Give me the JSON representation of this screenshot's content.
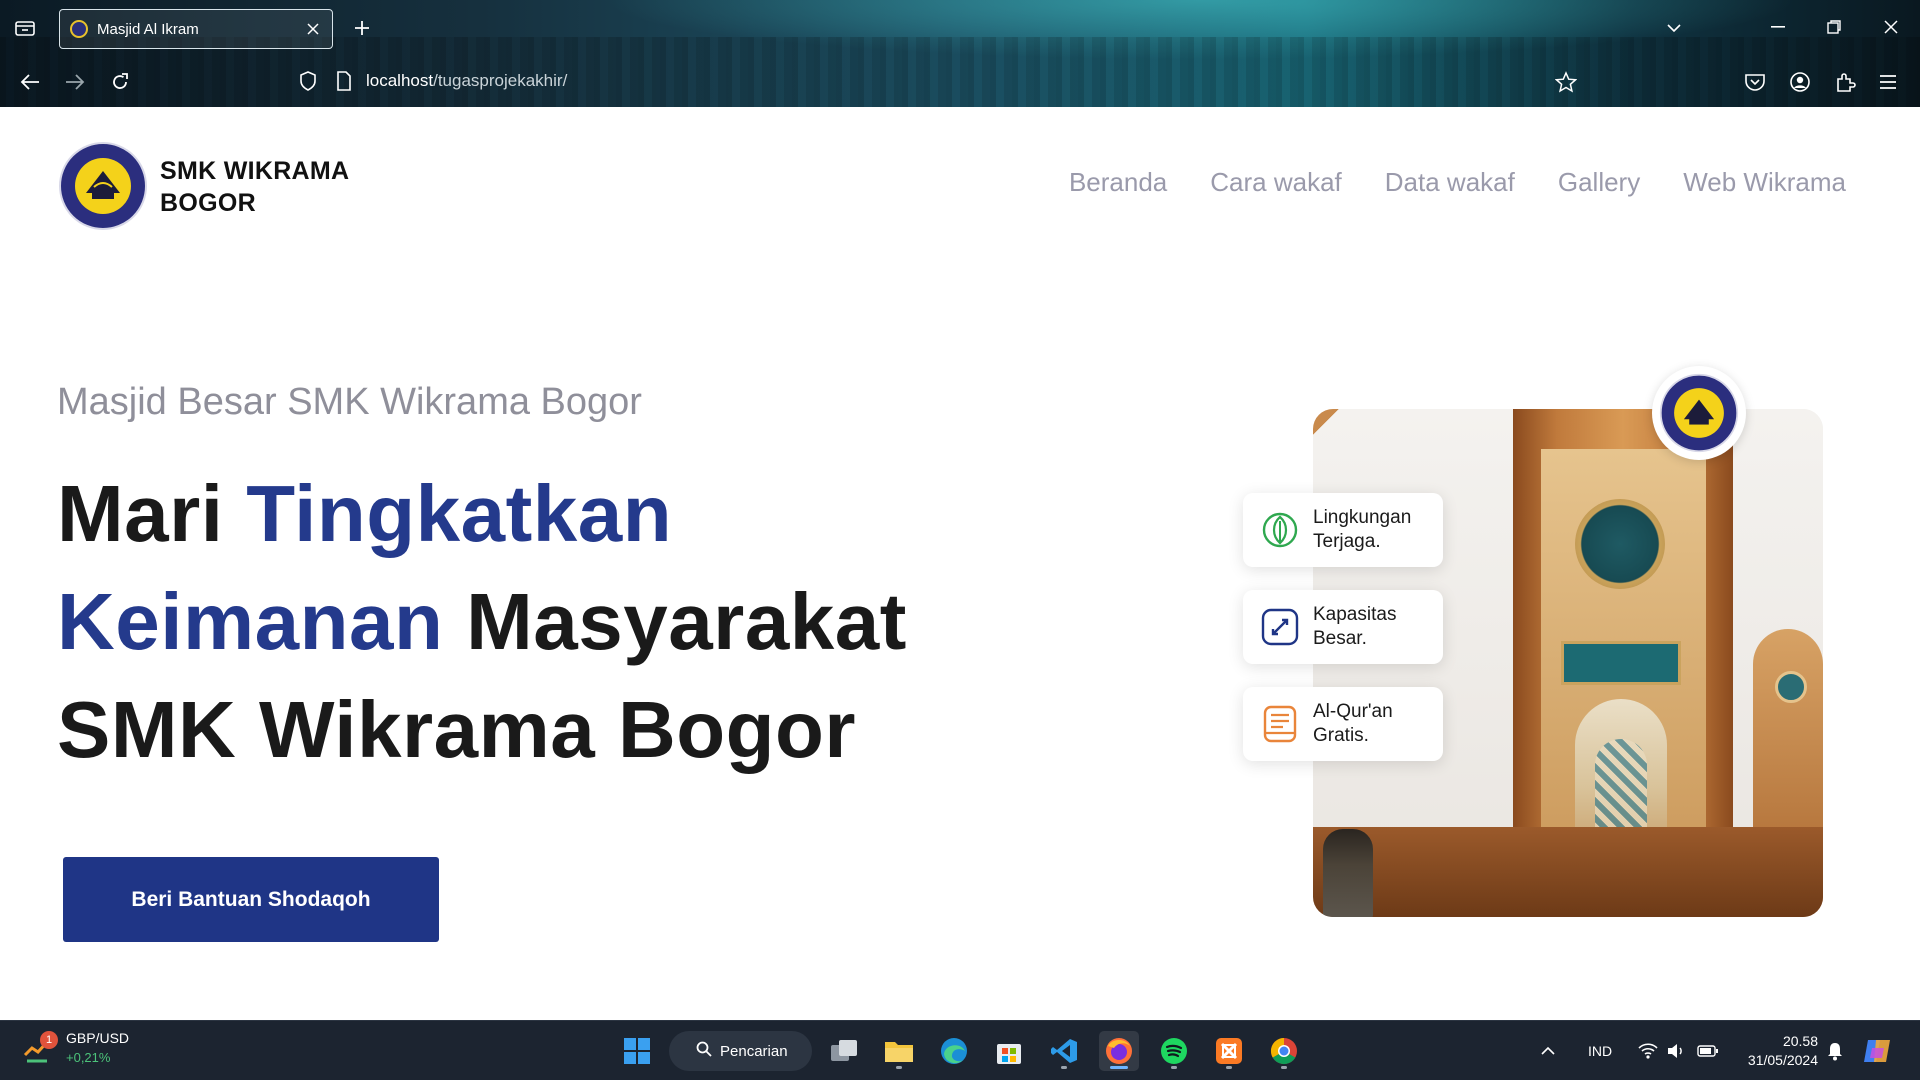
{
  "browser": {
    "tab_title": "Masjid Al Ikram",
    "url_host": "localhost",
    "url_path": "/tugasprojekakhir/"
  },
  "site": {
    "brand_line1": "SMK WIKRAMA",
    "brand_line2": "BOGOR",
    "nav": [
      "Beranda",
      "Cara wakaf",
      "Data wakaf",
      "Gallery",
      "Web Wikrama"
    ]
  },
  "hero": {
    "subtitle": "Masjid Besar SMK Wikrama Bogor",
    "headline_1a": "Mari ",
    "headline_1b": "Tingkatkan",
    "headline_2a": "Keimanan",
    "headline_2b": " Masyarakat",
    "headline_3": "SMK Wikrama Bogor",
    "cta": "Beri Bantuan Shodaqoh"
  },
  "features": [
    {
      "icon": "leaf-icon",
      "line1": "Lingkungan",
      "line2": "Terjaga.",
      "color": "#2fa84f"
    },
    {
      "icon": "expand-icon",
      "line1": "Kapasitas",
      "line2": "Besar.",
      "color": "#1f3586"
    },
    {
      "icon": "book-icon",
      "line1": "Al-Qur'an",
      "line2": "Gratis.",
      "color": "#e9853a"
    }
  ],
  "taskbar": {
    "widget_title": "GBP/USD",
    "widget_change": "+0,21%",
    "widget_badge": "1",
    "search_label": "Pencarian",
    "language": "IND",
    "time": "20.58",
    "date": "31/05/2024"
  },
  "colors": {
    "accent": "#1f3586",
    "headline_accent": "#243a8c"
  }
}
